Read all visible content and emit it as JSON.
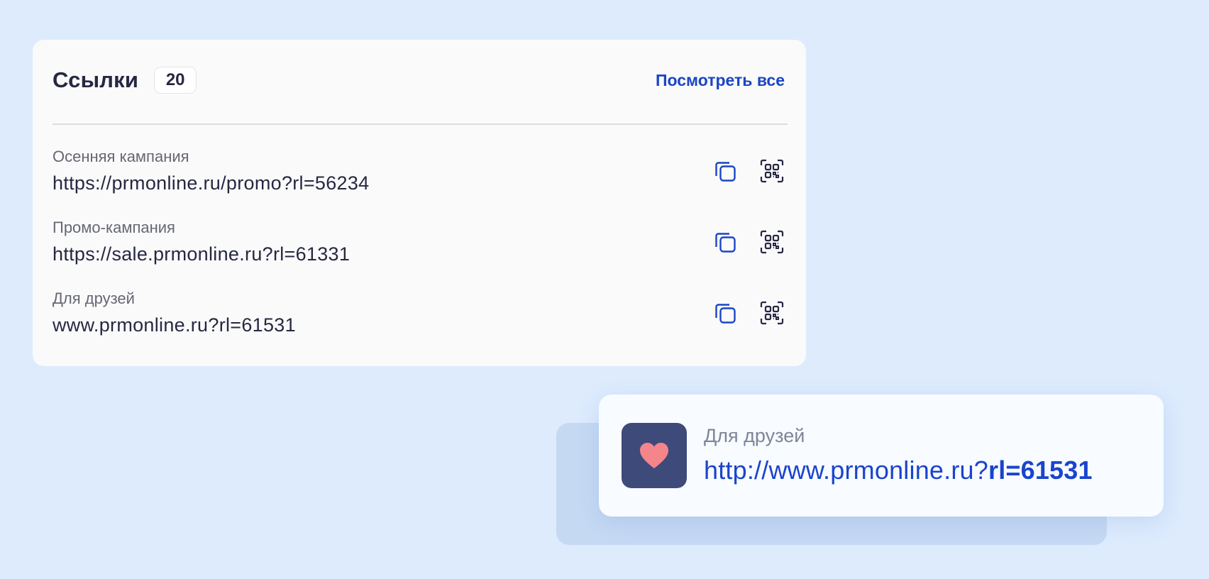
{
  "links_panel": {
    "title": "Ссылки",
    "count": "20",
    "view_all_label": "Посмотреть все",
    "items": [
      {
        "name": "Осенняя кампания",
        "url": "https://prmonline.ru/promo?rl=56234",
        "copy_icon": "copy-icon",
        "qr_icon": "qr-code-icon"
      },
      {
        "name": "Промо-кампания",
        "url": "https://sale.prmonline.ru?rl=61331",
        "copy_icon": "copy-icon",
        "qr_icon": "qr-code-icon"
      },
      {
        "name": "Для друзей",
        "url": "www.prmonline.ru?rl=61531",
        "copy_icon": "copy-icon",
        "qr_icon": "qr-code-icon"
      }
    ]
  },
  "shared_link_card": {
    "icon": "heart-icon",
    "name": "Для друзей",
    "url_base": "http://www.prmonline.ru?",
    "url_param": "rl=61531"
  },
  "colors": {
    "page_background": "#ddebfd",
    "accent_blue": "#1a45c4",
    "text_dark": "#262842",
    "text_muted": "#656775",
    "avatar_background": "#3e4a7a",
    "heart": "#f4858a"
  }
}
